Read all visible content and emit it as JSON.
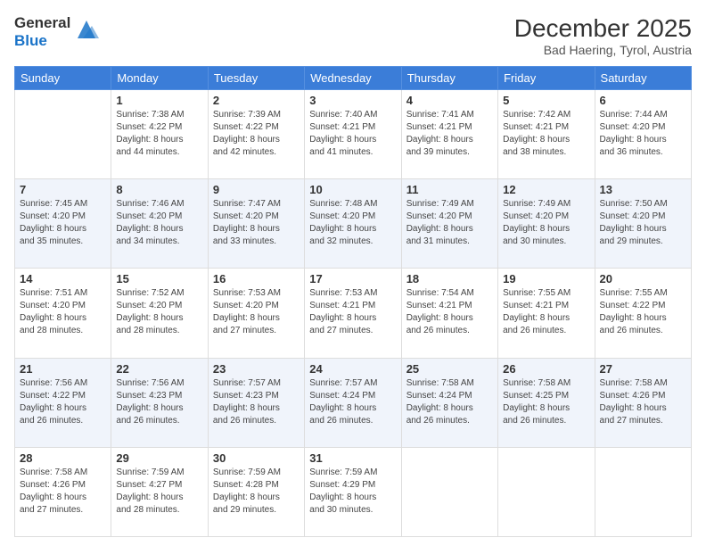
{
  "header": {
    "logo_line1": "General",
    "logo_line2": "Blue",
    "title": "December 2025",
    "subtitle": "Bad Haering, Tyrol, Austria"
  },
  "calendar": {
    "days_of_week": [
      "Sunday",
      "Monday",
      "Tuesday",
      "Wednesday",
      "Thursday",
      "Friday",
      "Saturday"
    ],
    "weeks": [
      [
        {
          "day": "",
          "info": ""
        },
        {
          "day": "1",
          "info": "Sunrise: 7:38 AM\nSunset: 4:22 PM\nDaylight: 8 hours\nand 44 minutes."
        },
        {
          "day": "2",
          "info": "Sunrise: 7:39 AM\nSunset: 4:22 PM\nDaylight: 8 hours\nand 42 minutes."
        },
        {
          "day": "3",
          "info": "Sunrise: 7:40 AM\nSunset: 4:21 PM\nDaylight: 8 hours\nand 41 minutes."
        },
        {
          "day": "4",
          "info": "Sunrise: 7:41 AM\nSunset: 4:21 PM\nDaylight: 8 hours\nand 39 minutes."
        },
        {
          "day": "5",
          "info": "Sunrise: 7:42 AM\nSunset: 4:21 PM\nDaylight: 8 hours\nand 38 minutes."
        },
        {
          "day": "6",
          "info": "Sunrise: 7:44 AM\nSunset: 4:20 PM\nDaylight: 8 hours\nand 36 minutes."
        }
      ],
      [
        {
          "day": "7",
          "info": "Sunrise: 7:45 AM\nSunset: 4:20 PM\nDaylight: 8 hours\nand 35 minutes."
        },
        {
          "day": "8",
          "info": "Sunrise: 7:46 AM\nSunset: 4:20 PM\nDaylight: 8 hours\nand 34 minutes."
        },
        {
          "day": "9",
          "info": "Sunrise: 7:47 AM\nSunset: 4:20 PM\nDaylight: 8 hours\nand 33 minutes."
        },
        {
          "day": "10",
          "info": "Sunrise: 7:48 AM\nSunset: 4:20 PM\nDaylight: 8 hours\nand 32 minutes."
        },
        {
          "day": "11",
          "info": "Sunrise: 7:49 AM\nSunset: 4:20 PM\nDaylight: 8 hours\nand 31 minutes."
        },
        {
          "day": "12",
          "info": "Sunrise: 7:49 AM\nSunset: 4:20 PM\nDaylight: 8 hours\nand 30 minutes."
        },
        {
          "day": "13",
          "info": "Sunrise: 7:50 AM\nSunset: 4:20 PM\nDaylight: 8 hours\nand 29 minutes."
        }
      ],
      [
        {
          "day": "14",
          "info": "Sunrise: 7:51 AM\nSunset: 4:20 PM\nDaylight: 8 hours\nand 28 minutes."
        },
        {
          "day": "15",
          "info": "Sunrise: 7:52 AM\nSunset: 4:20 PM\nDaylight: 8 hours\nand 28 minutes."
        },
        {
          "day": "16",
          "info": "Sunrise: 7:53 AM\nSunset: 4:20 PM\nDaylight: 8 hours\nand 27 minutes."
        },
        {
          "day": "17",
          "info": "Sunrise: 7:53 AM\nSunset: 4:21 PM\nDaylight: 8 hours\nand 27 minutes."
        },
        {
          "day": "18",
          "info": "Sunrise: 7:54 AM\nSunset: 4:21 PM\nDaylight: 8 hours\nand 26 minutes."
        },
        {
          "day": "19",
          "info": "Sunrise: 7:55 AM\nSunset: 4:21 PM\nDaylight: 8 hours\nand 26 minutes."
        },
        {
          "day": "20",
          "info": "Sunrise: 7:55 AM\nSunset: 4:22 PM\nDaylight: 8 hours\nand 26 minutes."
        }
      ],
      [
        {
          "day": "21",
          "info": "Sunrise: 7:56 AM\nSunset: 4:22 PM\nDaylight: 8 hours\nand 26 minutes."
        },
        {
          "day": "22",
          "info": "Sunrise: 7:56 AM\nSunset: 4:23 PM\nDaylight: 8 hours\nand 26 minutes."
        },
        {
          "day": "23",
          "info": "Sunrise: 7:57 AM\nSunset: 4:23 PM\nDaylight: 8 hours\nand 26 minutes."
        },
        {
          "day": "24",
          "info": "Sunrise: 7:57 AM\nSunset: 4:24 PM\nDaylight: 8 hours\nand 26 minutes."
        },
        {
          "day": "25",
          "info": "Sunrise: 7:58 AM\nSunset: 4:24 PM\nDaylight: 8 hours\nand 26 minutes."
        },
        {
          "day": "26",
          "info": "Sunrise: 7:58 AM\nSunset: 4:25 PM\nDaylight: 8 hours\nand 26 minutes."
        },
        {
          "day": "27",
          "info": "Sunrise: 7:58 AM\nSunset: 4:26 PM\nDaylight: 8 hours\nand 27 minutes."
        }
      ],
      [
        {
          "day": "28",
          "info": "Sunrise: 7:58 AM\nSunset: 4:26 PM\nDaylight: 8 hours\nand 27 minutes."
        },
        {
          "day": "29",
          "info": "Sunrise: 7:59 AM\nSunset: 4:27 PM\nDaylight: 8 hours\nand 28 minutes."
        },
        {
          "day": "30",
          "info": "Sunrise: 7:59 AM\nSunset: 4:28 PM\nDaylight: 8 hours\nand 29 minutes."
        },
        {
          "day": "31",
          "info": "Sunrise: 7:59 AM\nSunset: 4:29 PM\nDaylight: 8 hours\nand 30 minutes."
        },
        {
          "day": "",
          "info": ""
        },
        {
          "day": "",
          "info": ""
        },
        {
          "day": "",
          "info": ""
        }
      ]
    ]
  }
}
